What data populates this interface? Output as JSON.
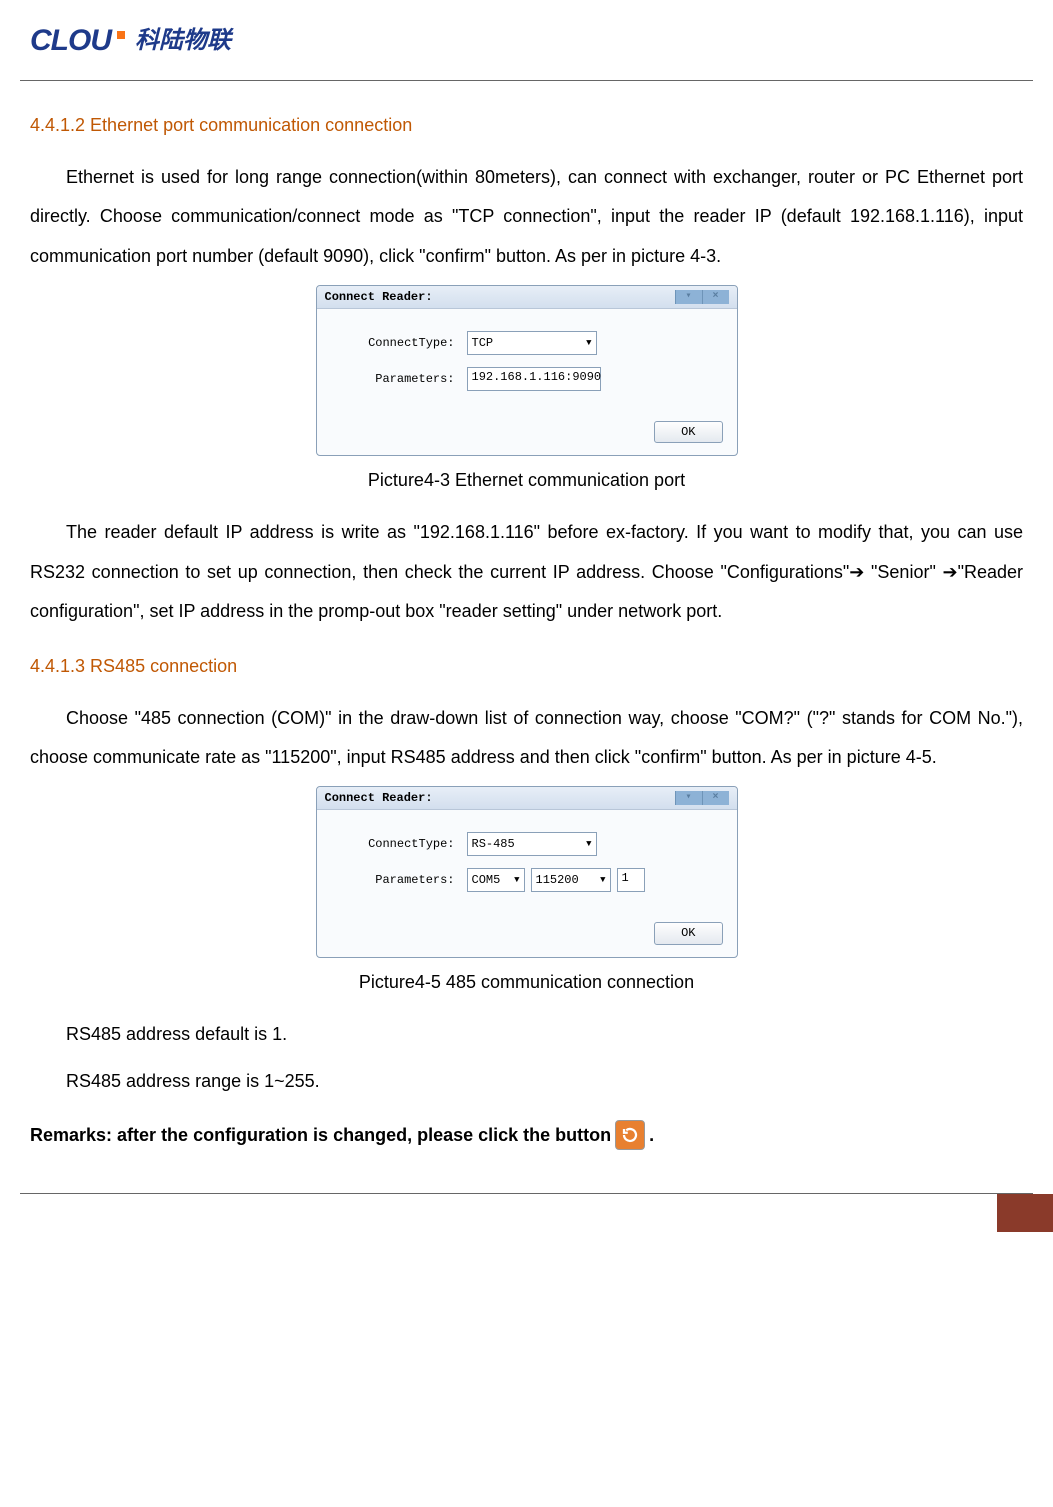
{
  "logo": {
    "en": "CLOU",
    "cn": "科陆物联"
  },
  "section1": {
    "heading": "4.4.1.2 Ethernet port communication connection",
    "para1": "Ethernet is used for long range connection(within 80meters), can connect with exchanger, router or PC Ethernet port directly. Choose communication/connect mode as \"TCP connection\", input the reader IP (default 192.168.1.116), input communication port number (default 9090), click \"confirm\" button. As per in picture 4-3.",
    "caption": "Picture4-3    Ethernet communication port",
    "para2": "The reader default IP address is write as \"192.168.1.116\" before ex-factory. If you want to modify that, you can use RS232 connection to set up connection, then check the current IP address. Choose \"Configurations\"➔ \"Senior\" ➔\"Reader configuration\", set IP address in the promp-out box \"reader setting\" under network port."
  },
  "section2": {
    "heading": "4.4.1.3 RS485 connection",
    "para1": "Choose \"485 connection (COM)\" in the draw-down list of connection way, choose \"COM?\" (\"?\" stands for COM No.\"), choose communicate rate as \"115200\", input RS485 address and then click \"confirm\" button. As per in picture 4-5.",
    "caption": "Picture4-5    485 communication connection",
    "note1": "RS485 address default is 1.",
    "note2": "RS485 address range is 1~255.",
    "remarks_prefix": "Remarks: after the configuration is changed, please click the button",
    "remarks_suffix": "."
  },
  "dialog1": {
    "title": "Connect Reader:",
    "label_type": "ConnectType:",
    "value_type": "TCP",
    "label_params": "Parameters:",
    "value_params": "192.168.1.116:9090",
    "ok": "OK"
  },
  "dialog2": {
    "title": "Connect Reader:",
    "label_type": "ConnectType:",
    "value_type": "RS-485",
    "label_params": "Parameters:",
    "value_com": "COM5",
    "value_baud": "115200",
    "value_addr": "1",
    "ok": "OK"
  }
}
